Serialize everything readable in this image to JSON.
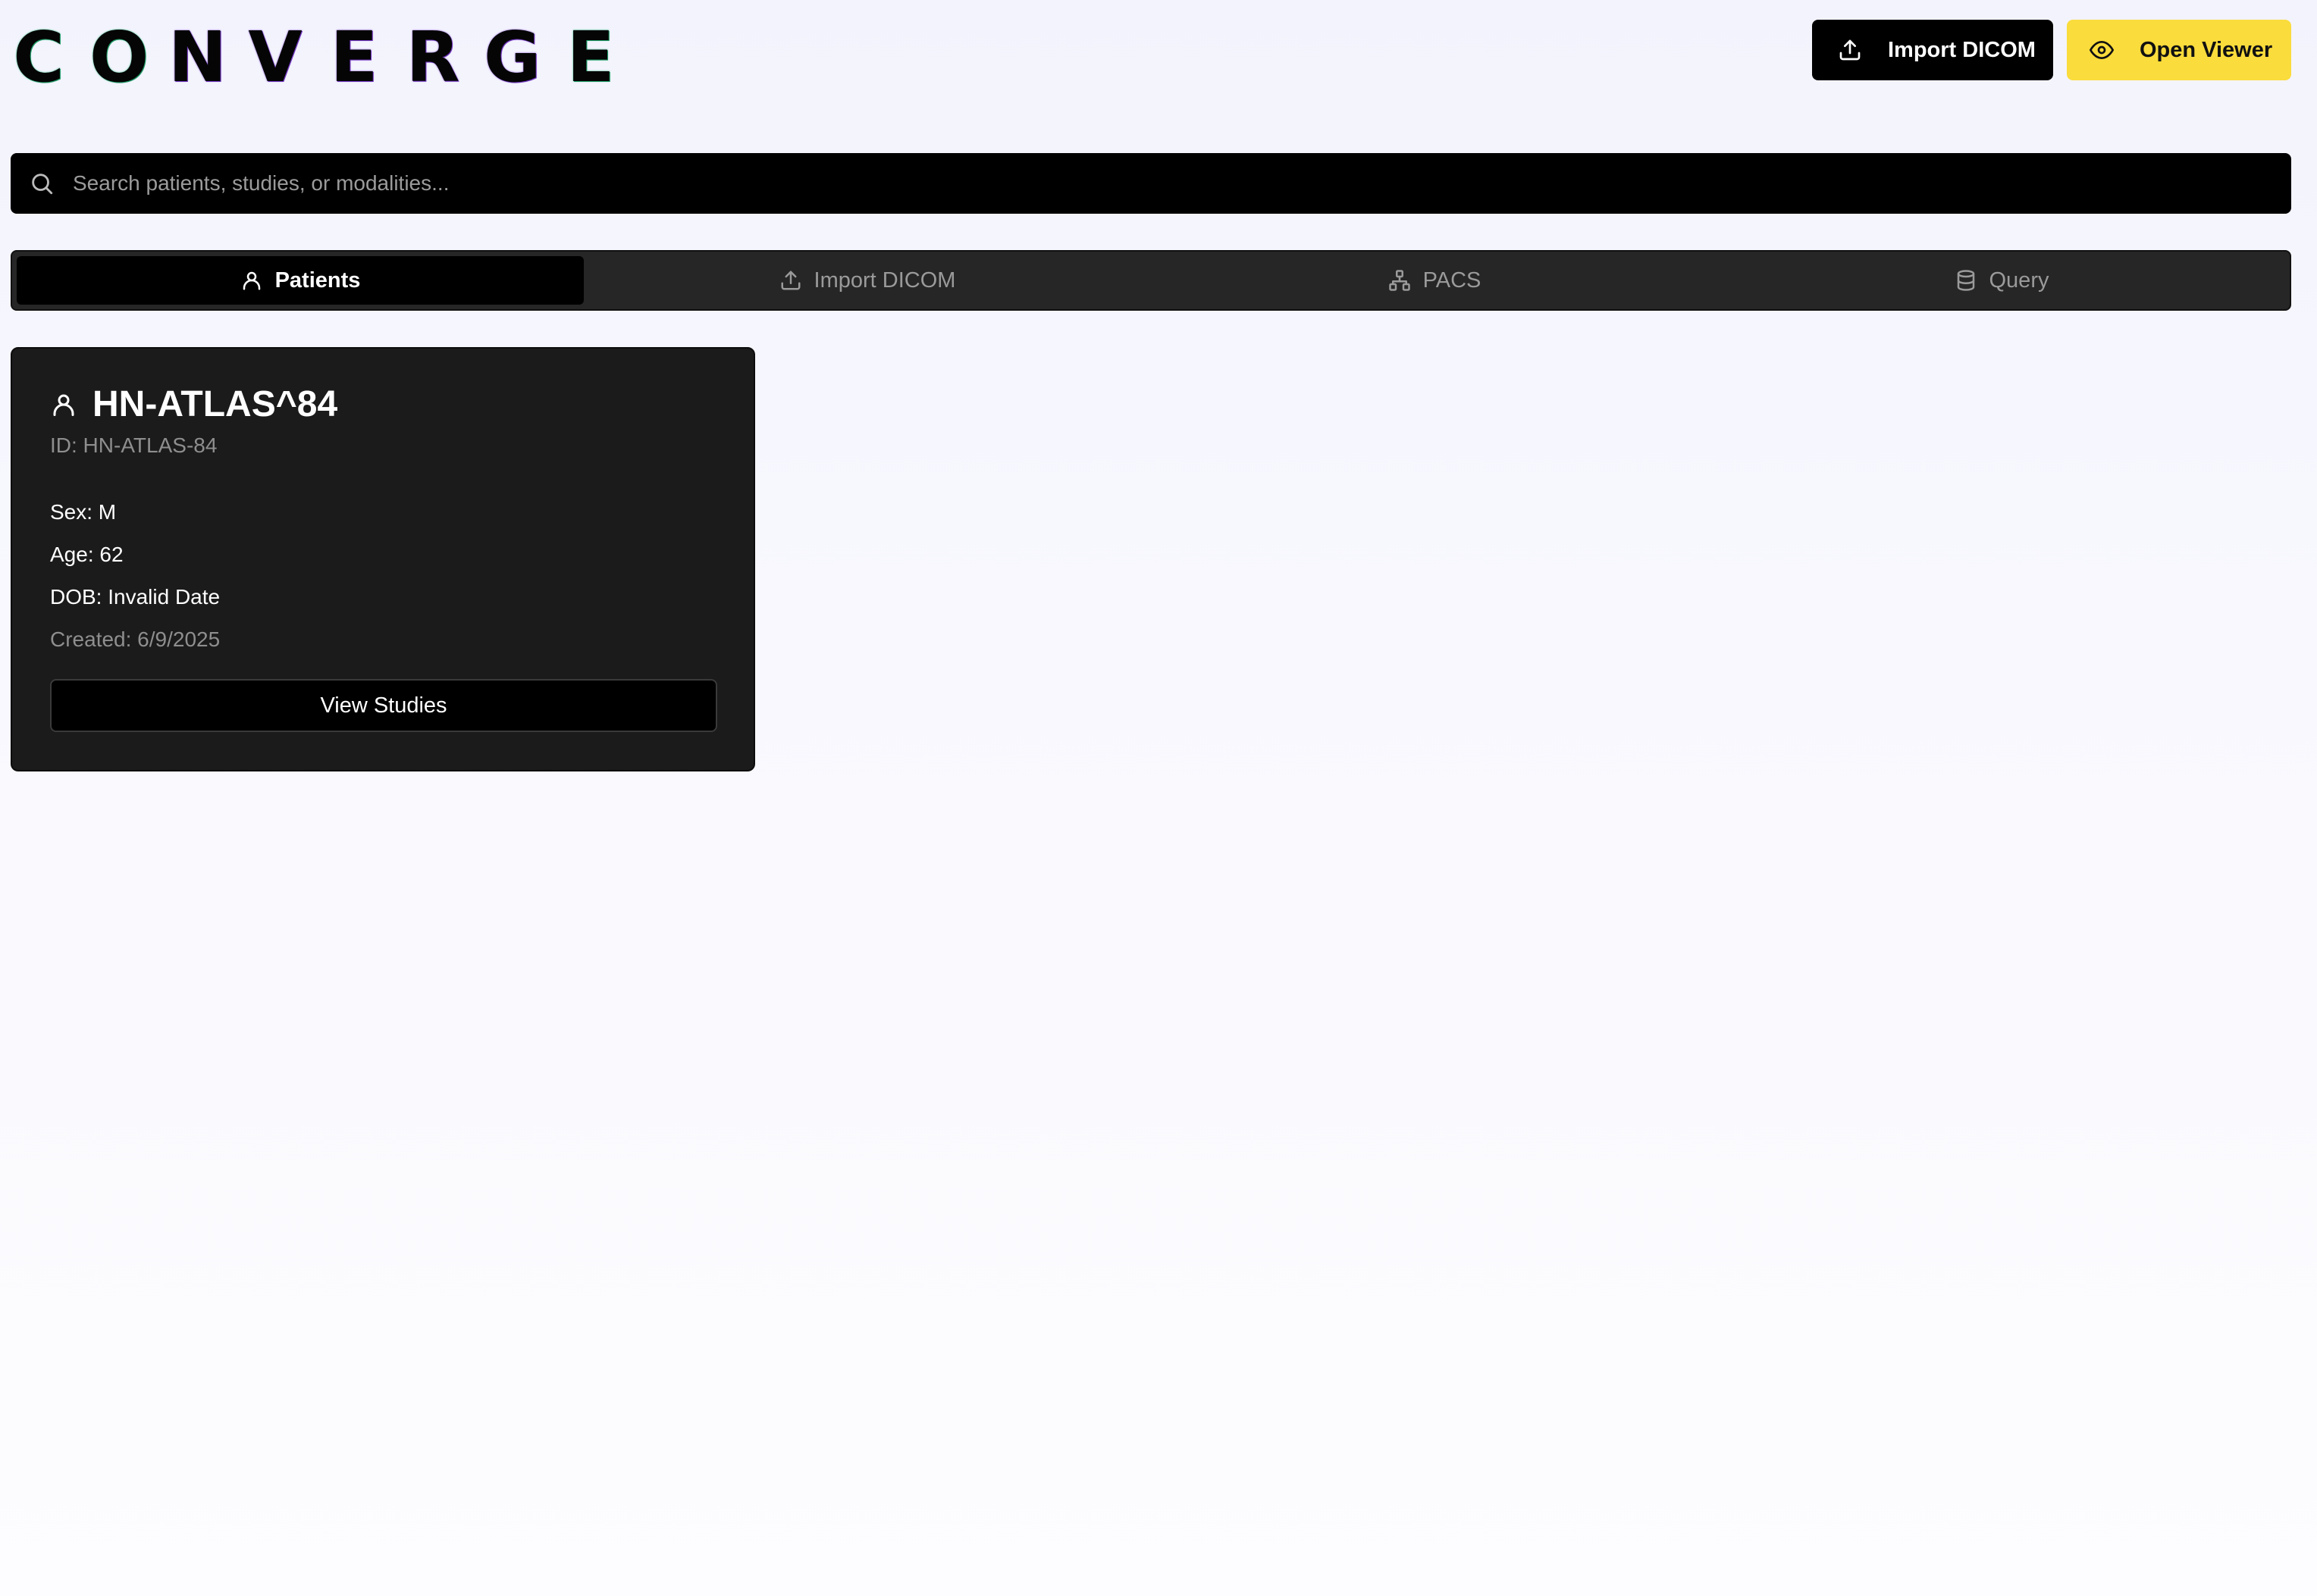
{
  "app": {
    "logo_letters": [
      "C",
      "O",
      "N",
      "V",
      "E",
      "R",
      "G",
      "E"
    ]
  },
  "header": {
    "import_label": "Import DICOM",
    "import_icon": "upload-icon",
    "viewer_label": "Open Viewer",
    "viewer_icon": "eye-icon",
    "viewer_color": "#fadc3c"
  },
  "search": {
    "placeholder": "Search patients, studies, or modalities...",
    "value": "",
    "icon": "search-icon"
  },
  "tabs": [
    {
      "label": "Patients",
      "icon": "user-icon",
      "active": true
    },
    {
      "label": "Import DICOM",
      "icon": "upload-icon",
      "active": false
    },
    {
      "label": "PACS",
      "icon": "network-icon",
      "active": false
    },
    {
      "label": "Query",
      "icon": "database-icon",
      "active": false
    }
  ],
  "patient_card": {
    "name": "HN-ATLAS^84",
    "id_text": "ID: HN-ATLAS-84",
    "sex": "Sex: M",
    "age": "Age: 62",
    "dob": "DOB: Invalid Date",
    "created": "Created: 6/9/2025",
    "view_button": "View Studies"
  }
}
